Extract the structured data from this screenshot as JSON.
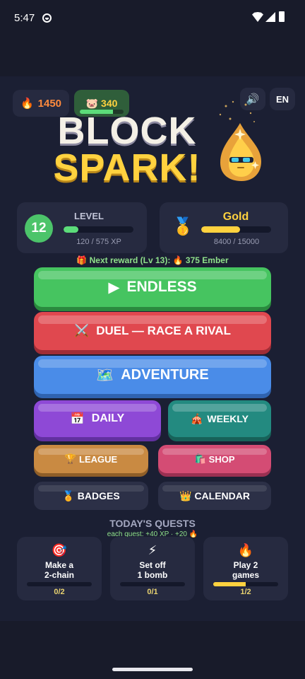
{
  "status_bar": {
    "time": "5:47"
  },
  "header": {
    "fire_count": "1450",
    "ember_count": "340",
    "ember_progress": 0.75,
    "lang": "EN",
    "sound_icon": "speaker-icon"
  },
  "title": {
    "line1": "BLOCK",
    "line2": "SPARK!"
  },
  "level": {
    "number": "12",
    "label": "LEVEL",
    "xp_text": "120 / 575 XP",
    "progress": 0.21
  },
  "rank": {
    "name": "Gold",
    "xp_text": "8400 / 15000",
    "progress": 0.56,
    "medal_icon": "gold-medal-icon"
  },
  "next_reward": "🎁 Next reward (Lv 13): 🔥 375 Ember",
  "buttons": {
    "endless": "ENDLESS",
    "duel": "DUEL — RACE A RIVAL",
    "adventure": "ADVENTURE",
    "daily": "DAILY",
    "weekly": "WEEKLY",
    "league": "LEAGUE",
    "shop": "SHOP",
    "badges": "BADGES",
    "calendar": "CALENDAR"
  },
  "quests": {
    "title": "TODAY'S QUESTS",
    "subtitle": "each quest: +40 XP · +20 🔥",
    "items": [
      {
        "icon": "🎯",
        "text": "Make a\n2-chain",
        "progress_text": "0/2",
        "progress": 0
      },
      {
        "icon": "⚡",
        "text": "Set off\n1 bomb",
        "progress_text": "0/1",
        "progress": 0
      },
      {
        "icon": "🔥",
        "text": "Play 2\ngames",
        "progress_text": "1/2",
        "progress": 0.5
      }
    ]
  },
  "colors": {
    "background": "#1b1f33",
    "accent_gold": "#ffd23f",
    "accent_green": "#46c460"
  }
}
